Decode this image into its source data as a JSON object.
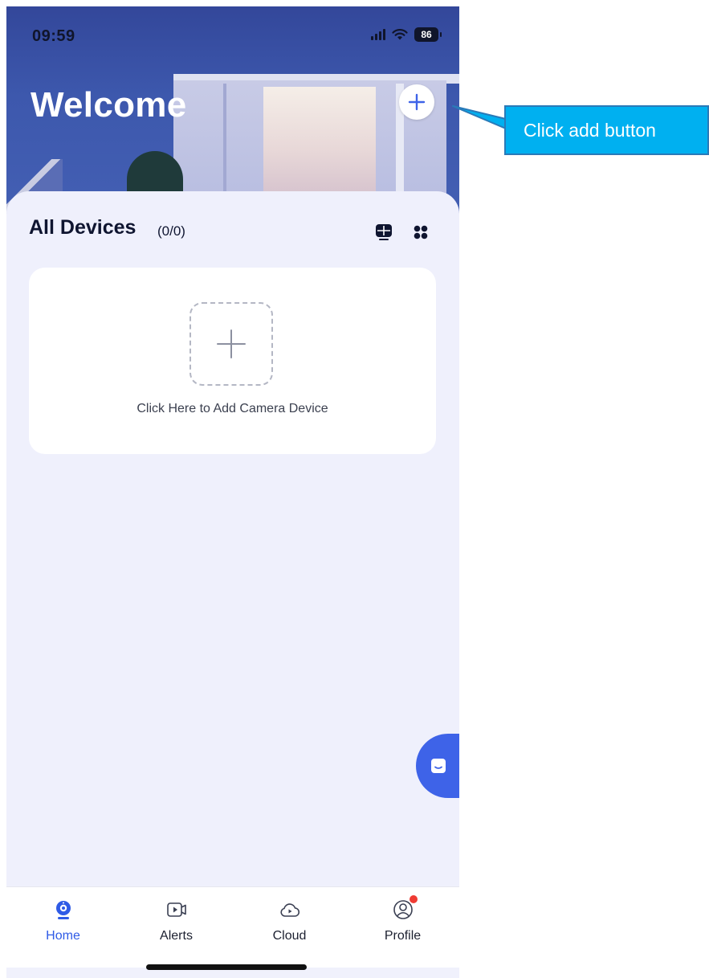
{
  "status_bar": {
    "time": "09:59",
    "battery": "86"
  },
  "header": {
    "title": "Welcome"
  },
  "devices": {
    "title": "All Devices",
    "count": "(0/0)",
    "add_prompt": "Click Here to Add Camera Device"
  },
  "tabs": [
    {
      "label": "Home",
      "icon": "camera-icon",
      "active": true
    },
    {
      "label": "Alerts",
      "icon": "video-play-icon",
      "active": false
    },
    {
      "label": "Cloud",
      "icon": "cloud-play-icon",
      "active": false
    },
    {
      "label": "Profile",
      "icon": "user-icon",
      "active": false
    }
  ],
  "annotation": {
    "text": "Click add button"
  },
  "colors": {
    "accent": "#3e63e8",
    "tab_active": "#2f5be6",
    "callout": "#00b0f0",
    "badge": "#ef3b33"
  }
}
